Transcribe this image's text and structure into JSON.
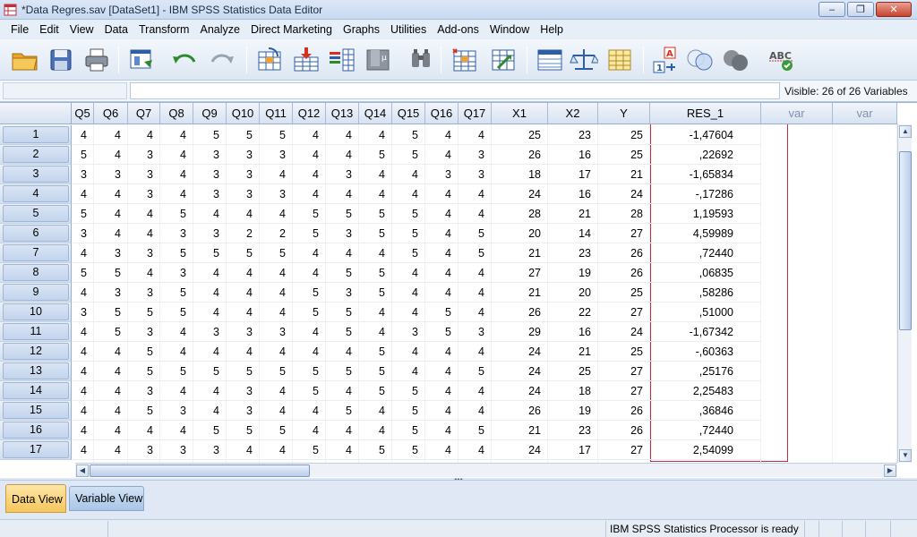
{
  "window": {
    "title": "*Data Regres.sav [DataSet1] - IBM SPSS Statistics Data Editor",
    "minimize_label": "–",
    "restore_label": "❐",
    "close_label": "✕"
  },
  "menu": [
    "File",
    "Edit",
    "View",
    "Data",
    "Transform",
    "Analyze",
    "Direct Marketing",
    "Graphs",
    "Utilities",
    "Add-ons",
    "Window",
    "Help"
  ],
  "toolbar_icons": [
    "open-folder-icon",
    "save-icon",
    "print-icon",
    "recall-dialog-icon",
    "undo-icon",
    "redo-icon",
    "go-to-case-icon",
    "go-to-variable-icon",
    "variables-icon",
    "run-descriptives-icon",
    "find-icon",
    "insert-cases-icon",
    "insert-variable-icon",
    "split-file-icon",
    "weight-cases-icon",
    "select-cases-icon",
    "value-labels-icon",
    "use-variable-sets-icon",
    "show-all-variables-icon",
    "spell-check-icon"
  ],
  "editbar": {
    "cell_reference": "",
    "cell_value": "",
    "visible_info": "Visible: 26 of 26 Variables"
  },
  "grid": {
    "columns": [
      "Q5",
      "Q6",
      "Q7",
      "Q8",
      "Q9",
      "Q10",
      "Q11",
      "Q12",
      "Q13",
      "Q14",
      "Q15",
      "Q16",
      "Q17",
      "X1",
      "X2",
      "Y",
      "RES_1",
      "var",
      "var"
    ],
    "rows": [
      {
        "n": "1",
        "cells": [
          "4",
          "4",
          "4",
          "4",
          "5",
          "5",
          "5",
          "4",
          "4",
          "4",
          "5",
          "4",
          "4",
          "25",
          "23",
          "25",
          "-1,47604"
        ]
      },
      {
        "n": "2",
        "cells": [
          "5",
          "4",
          "3",
          "4",
          "3",
          "3",
          "3",
          "4",
          "4",
          "5",
          "5",
          "4",
          "3",
          "26",
          "16",
          "25",
          ",22692"
        ]
      },
      {
        "n": "3",
        "cells": [
          "3",
          "3",
          "3",
          "4",
          "3",
          "3",
          "4",
          "4",
          "3",
          "4",
          "4",
          "3",
          "3",
          "18",
          "17",
          "21",
          "-1,65834"
        ]
      },
      {
        "n": "4",
        "cells": [
          "4",
          "4",
          "3",
          "4",
          "3",
          "3",
          "3",
          "4",
          "4",
          "4",
          "4",
          "4",
          "4",
          "24",
          "16",
          "24",
          "-,17286"
        ]
      },
      {
        "n": "5",
        "cells": [
          "5",
          "4",
          "4",
          "5",
          "4",
          "4",
          "4",
          "5",
          "5",
          "5",
          "5",
          "4",
          "4",
          "28",
          "21",
          "28",
          "1,19593"
        ]
      },
      {
        "n": "6",
        "cells": [
          "3",
          "4",
          "4",
          "3",
          "3",
          "2",
          "2",
          "5",
          "3",
          "5",
          "5",
          "4",
          "5",
          "20",
          "14",
          "27",
          "4,59989"
        ]
      },
      {
        "n": "7",
        "cells": [
          "4",
          "3",
          "3",
          "5",
          "5",
          "5",
          "5",
          "4",
          "4",
          "4",
          "5",
          "4",
          "5",
          "21",
          "23",
          "26",
          ",72440"
        ]
      },
      {
        "n": "8",
        "cells": [
          "5",
          "5",
          "4",
          "3",
          "4",
          "4",
          "4",
          "4",
          "5",
          "5",
          "4",
          "4",
          "4",
          "27",
          "19",
          "26",
          ",06835"
        ]
      },
      {
        "n": "9",
        "cells": [
          "4",
          "3",
          "3",
          "5",
          "4",
          "4",
          "4",
          "5",
          "3",
          "5",
          "4",
          "4",
          "4",
          "21",
          "20",
          "25",
          ",58286"
        ]
      },
      {
        "n": "10",
        "cells": [
          "3",
          "5",
          "5",
          "5",
          "4",
          "4",
          "4",
          "5",
          "5",
          "4",
          "4",
          "5",
          "4",
          "26",
          "22",
          "27",
          ",51000"
        ]
      },
      {
        "n": "11",
        "cells": [
          "4",
          "5",
          "3",
          "4",
          "3",
          "3",
          "3",
          "4",
          "5",
          "4",
          "3",
          "5",
          "3",
          "29",
          "16",
          "24",
          "-1,67342"
        ]
      },
      {
        "n": "12",
        "cells": [
          "4",
          "4",
          "5",
          "4",
          "4",
          "4",
          "4",
          "4",
          "4",
          "5",
          "4",
          "4",
          "4",
          "24",
          "21",
          "25",
          "-,60363"
        ]
      },
      {
        "n": "13",
        "cells": [
          "4",
          "4",
          "5",
          "5",
          "5",
          "5",
          "5",
          "5",
          "5",
          "5",
          "4",
          "4",
          "5",
          "24",
          "25",
          "27",
          ",25176"
        ]
      },
      {
        "n": "14",
        "cells": [
          "4",
          "4",
          "3",
          "4",
          "4",
          "3",
          "4",
          "5",
          "4",
          "5",
          "5",
          "4",
          "4",
          "24",
          "18",
          "27",
          "2,25483"
        ]
      },
      {
        "n": "15",
        "cells": [
          "4",
          "4",
          "5",
          "3",
          "4",
          "3",
          "4",
          "4",
          "5",
          "4",
          "5",
          "4",
          "4",
          "26",
          "19",
          "26",
          ",36846"
        ]
      },
      {
        "n": "16",
        "cells": [
          "4",
          "4",
          "4",
          "4",
          "5",
          "5",
          "5",
          "4",
          "4",
          "4",
          "5",
          "4",
          "5",
          "21",
          "23",
          "26",
          ",72440"
        ]
      },
      {
        "n": "17",
        "cells": [
          "4",
          "4",
          "3",
          "3",
          "3",
          "4",
          "4",
          "5",
          "4",
          "5",
          "5",
          "4",
          "4",
          "24",
          "17",
          "27",
          "2,54099"
        ]
      }
    ]
  },
  "tabs": [
    "Data View",
    "Variable View"
  ],
  "status": {
    "processor": "IBM SPSS Statistics Processor is ready"
  }
}
